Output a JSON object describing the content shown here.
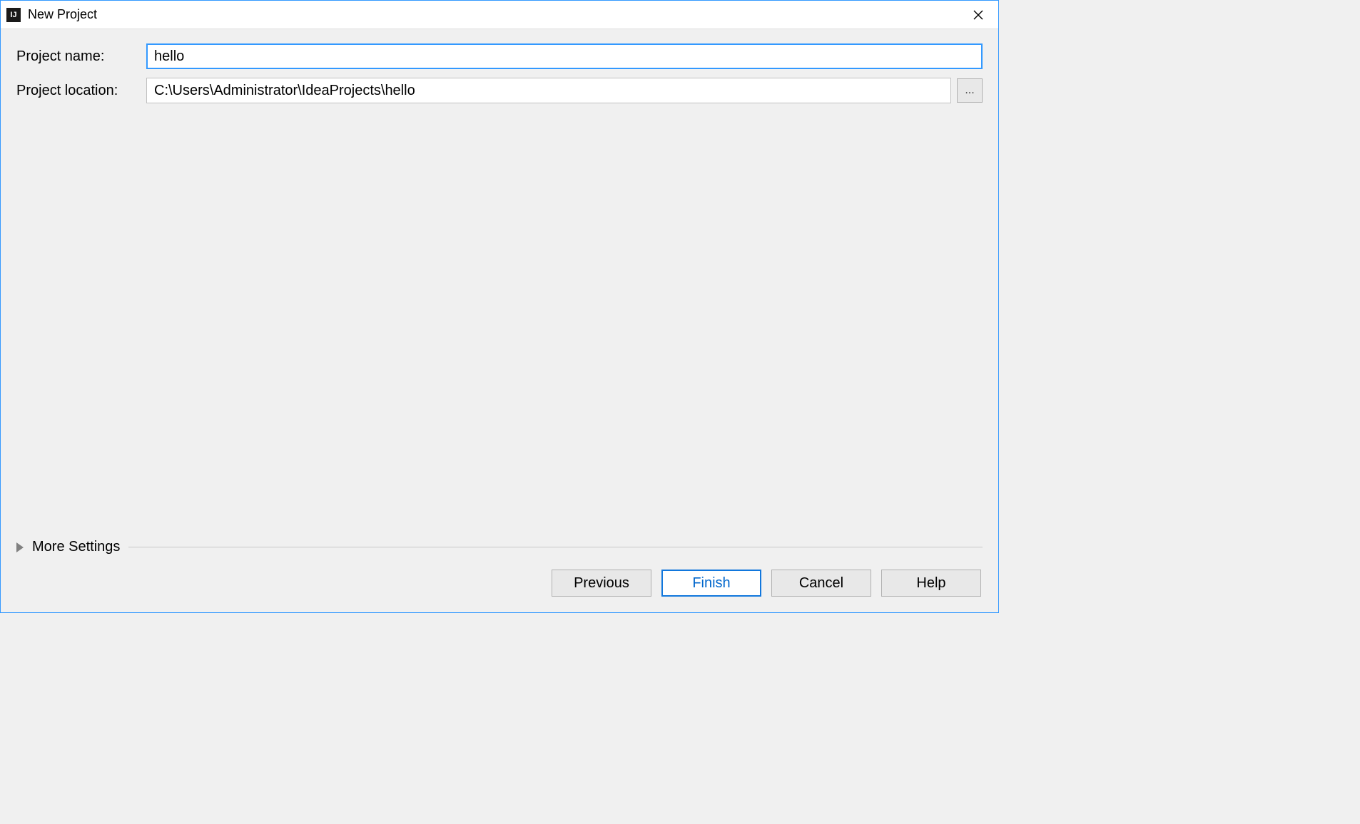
{
  "titlebar": {
    "title": "New Project"
  },
  "form": {
    "project_name_label": "Project name:",
    "project_name_value": "hello",
    "project_location_label": "Project location:",
    "project_location_value": "C:\\Users\\Administrator\\IdeaProjects\\hello",
    "browse_label": "..."
  },
  "more_settings": {
    "label": "More Settings"
  },
  "buttons": {
    "previous": "Previous",
    "finish": "Finish",
    "cancel": "Cancel",
    "help": "Help"
  }
}
